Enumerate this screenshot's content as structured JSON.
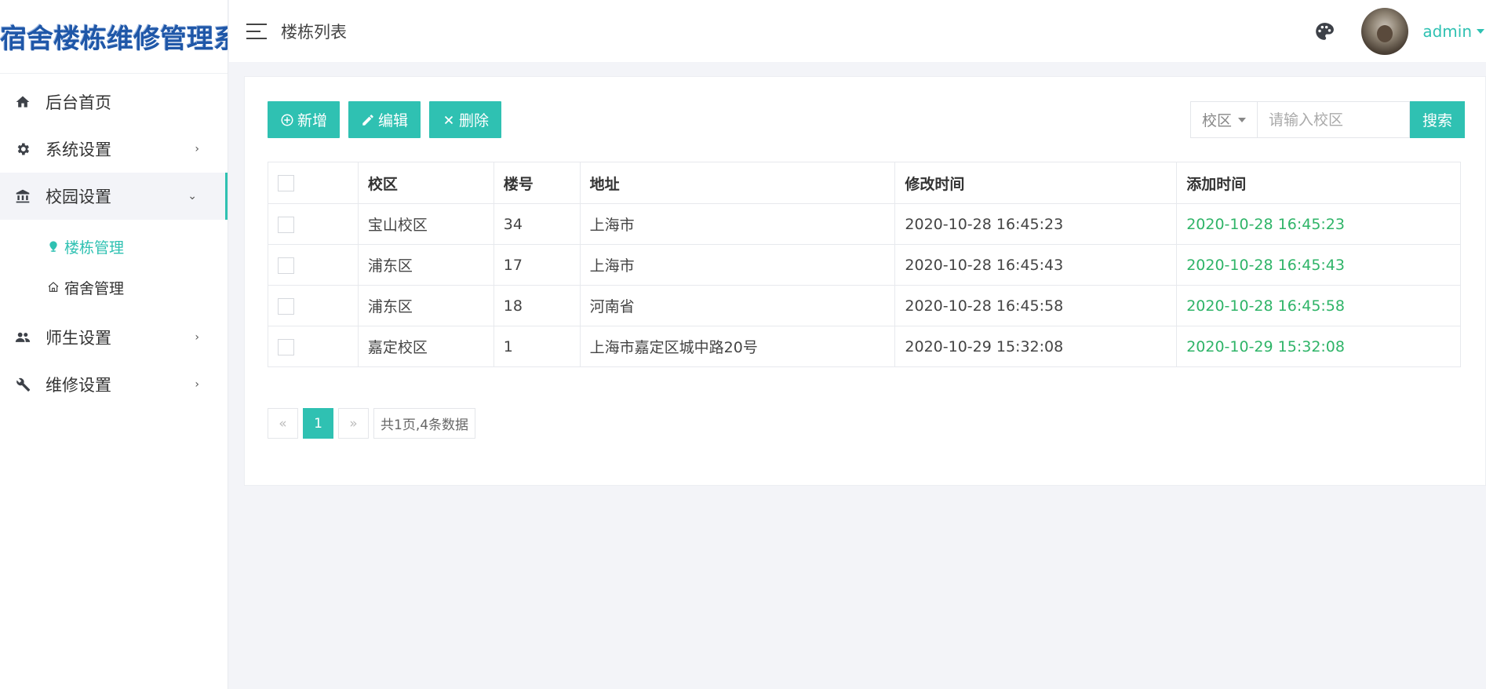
{
  "app": {
    "title": "宿舍楼栋维修管理系统"
  },
  "sidebar": {
    "items": [
      {
        "label": "后台首页",
        "icon": "home-icon"
      },
      {
        "label": "系统设置",
        "icon": "gear-icon",
        "arrow": "›"
      },
      {
        "label": "校园设置",
        "icon": "bank-icon",
        "arrow": "⌄",
        "children": [
          {
            "label": "楼栋管理",
            "icon": "location-icon"
          },
          {
            "label": "宿舍管理",
            "icon": "house-icon"
          }
        ]
      },
      {
        "label": "师生设置",
        "icon": "users-icon",
        "arrow": "›"
      },
      {
        "label": "维修设置",
        "icon": "wrench-icon",
        "arrow": "›"
      }
    ]
  },
  "header": {
    "title": "楼栋列表",
    "user": "admin"
  },
  "toolbar": {
    "add": "新增",
    "edit": "编辑",
    "delete": "删除"
  },
  "search": {
    "field": "校区",
    "placeholder": "请输入校区",
    "button": "搜索"
  },
  "table": {
    "columns": [
      "校区",
      "楼号",
      "地址",
      "修改时间",
      "添加时间"
    ],
    "rows": [
      [
        "宝山校区",
        "34",
        "上海市",
        "2020-10-28 16:45:23",
        "2020-10-28 16:45:23"
      ],
      [
        "浦东区",
        "17",
        "上海市",
        "2020-10-28 16:45:43",
        "2020-10-28 16:45:43"
      ],
      [
        "浦东区",
        "18",
        "河南省",
        "2020-10-28 16:45:58",
        "2020-10-28 16:45:58"
      ],
      [
        "嘉定校区",
        "1",
        "上海市嘉定区城中路20号",
        "2020-10-29 15:32:08",
        "2020-10-29 15:32:08"
      ]
    ]
  },
  "pagination": {
    "prev": "«",
    "current": "1",
    "next": "»",
    "summary": "共1页,4条数据"
  },
  "colors": {
    "accent": "#2fc1b2",
    "time_green": "#2fb468",
    "logo_blue": "#1f57a8"
  }
}
